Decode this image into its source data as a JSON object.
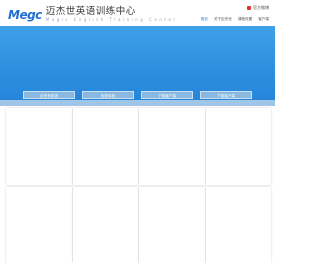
{
  "logo": {
    "mark": "Megc",
    "cn": "迈杰世英语训练中心",
    "en": "Magic English Training Center"
  },
  "top_right": {
    "label": "官方微博"
  },
  "nav": {
    "items": [
      {
        "label": "首页",
        "active": true
      },
      {
        "label": "关于迈杰世",
        "active": false
      },
      {
        "label": "课程设置",
        "active": false
      },
      {
        "label": "客户端",
        "active": false
      }
    ]
  },
  "banner_buttons": [
    {
      "label": "迈杰世英语"
    },
    {
      "label": "免费体验"
    },
    {
      "label": "下载客户端"
    },
    {
      "label": "下载客户端"
    }
  ]
}
